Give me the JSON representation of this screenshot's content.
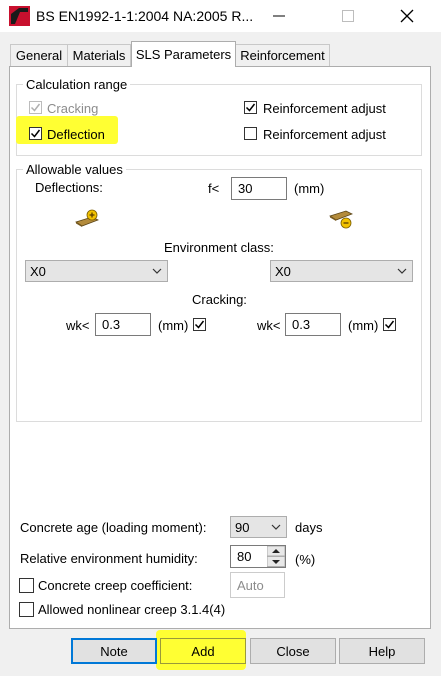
{
  "window": {
    "title": "BS EN1992-1-1:2004 NA:2005 R..."
  },
  "tabs": [
    {
      "label": "General"
    },
    {
      "label": "Materials"
    },
    {
      "label": "SLS Parameters"
    },
    {
      "label": "Reinforcement"
    }
  ],
  "calculation_range": {
    "label": "Calculation range",
    "cracking": {
      "label": "Cracking",
      "checked": true,
      "enabled": false
    },
    "deflection": {
      "label": "Deflection",
      "checked": true
    },
    "reinf_adjust_1": {
      "label": "Reinforcement adjust",
      "checked": true
    },
    "reinf_adjust_2": {
      "label": "Reinforcement adjust",
      "checked": false
    }
  },
  "allowable_values": {
    "label": "Allowable values",
    "deflections_label": "Deflections:",
    "f_label": "f<",
    "f_value": "30",
    "f_unit": "(mm)",
    "environment_class_label": "Environment class:",
    "env_left": "X0",
    "env_right": "X0",
    "cracking_label": "Cracking:",
    "wk_label_left": "wk<",
    "wk_value_left": "0.3",
    "wk_unit_left": "(mm)",
    "wk_check_left": true,
    "wk_label_right": "wk<",
    "wk_value_right": "0.3",
    "wk_unit_right": "(mm)",
    "wk_check_right": true
  },
  "lower": {
    "concrete_age_label": "Concrete age (loading moment):",
    "concrete_age_value": "90",
    "concrete_age_unit": "days",
    "humidity_label": "Relative environment humidity:",
    "humidity_value": "80",
    "humidity_unit": "(%)",
    "creep_coeff_label": "Concrete creep coefficient:",
    "creep_coeff_value": "Auto",
    "nonlinear_creep_label": "Allowed nonlinear creep 3.1.4(4)"
  },
  "buttons": {
    "note": "Note",
    "add": "Add",
    "close": "Close",
    "help": "Help"
  },
  "colors": {
    "highlight": "#ffff33",
    "accent": "#0078d7",
    "icon_red": "#c8102e"
  }
}
